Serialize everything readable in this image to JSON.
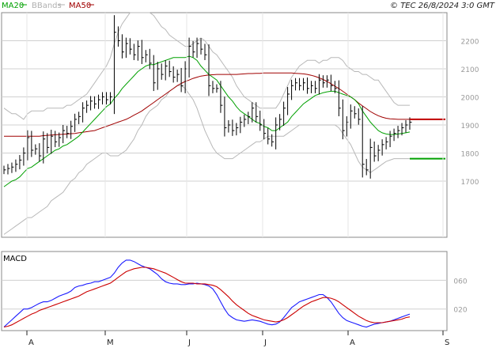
{
  "header": {
    "legend": [
      {
        "name": "MA20",
        "color": "#00a000"
      },
      {
        "name": "BBands",
        "color": "#b0b0b0"
      },
      {
        "name": "MA50",
        "color": "#a00000"
      }
    ],
    "copyright": "© TEC 26/8/2024 3:0 GMT"
  },
  "chart_data": [
    {
      "type": "line",
      "panel": "price",
      "grid": true,
      "ylim": [
        1500,
        2300
      ],
      "y_ticks": [
        1700,
        1800,
        1900,
        2000,
        2100,
        2200
      ],
      "x_labels": [
        "A",
        "M",
        "J",
        "J",
        "A",
        "S"
      ],
      "close": [
        1740,
        1745,
        1750,
        1760,
        1775,
        1800,
        1855,
        1810,
        1815,
        1790,
        1850,
        1820,
        1860,
        1840,
        1855,
        1880,
        1870,
        1895,
        1920,
        1930,
        1960,
        1970,
        1985,
        1975,
        1990,
        2000,
        1990,
        2000,
        2230,
        2200,
        2160,
        2190,
        2170,
        2150,
        2180,
        2140,
        2150,
        2120,
        2050,
        2100,
        2080,
        2110,
        2090,
        2070,
        2080,
        2040,
        2100,
        2180,
        2160,
        2190,
        2170,
        2150,
        2040,
        2030,
        2030,
        1970,
        1890,
        1900,
        1880,
        1890,
        1910,
        1920,
        1930,
        1960,
        1930,
        1900,
        1870,
        1850,
        1840,
        1900,
        1920,
        1960,
        2010,
        2040,
        2050,
        2040,
        2050,
        2030,
        2040,
        2030,
        2060,
        2050,
        2060,
        2040,
        2030,
        1960,
        1880,
        1910,
        1950,
        1940,
        1920,
        1760,
        1740,
        1820,
        1790,
        1810,
        1830,
        1840,
        1860,
        1870,
        1880,
        1890,
        1900,
        1910
      ],
      "ma20": [
        1680,
        1690,
        1700,
        1705,
        1715,
        1730,
        1745,
        1750,
        1760,
        1770,
        1780,
        1790,
        1800,
        1810,
        1815,
        1825,
        1830,
        1840,
        1850,
        1860,
        1875,
        1890,
        1905,
        1920,
        1935,
        1950,
        1965,
        1975,
        1995,
        2010,
        2030,
        2045,
        2060,
        2075,
        2090,
        2100,
        2110,
        2115,
        2115,
        2120,
        2125,
        2130,
        2135,
        2140,
        2140,
        2140,
        2140,
        2145,
        2140,
        2130,
        2110,
        2095,
        2080,
        2070,
        2060,
        2040,
        2020,
        2000,
        1985,
        1965,
        1950,
        1940,
        1930,
        1920,
        1910,
        1905,
        1895,
        1890,
        1880,
        1880,
        1890,
        1900,
        1910,
        1930,
        1945,
        1960,
        1975,
        1985,
        1995,
        2005,
        2010,
        2015,
        2018,
        2020,
        2020,
        2015,
        2010,
        2005,
        2000,
        1990,
        1975,
        1950,
        1930,
        1910,
        1895,
        1880,
        1872,
        1868,
        1866,
        1866,
        1868,
        1870,
        1872,
        1875
      ],
      "ma50": [
        1860,
        1860,
        1860,
        1860,
        1860,
        1860,
        1860,
        1860,
        1860,
        1860,
        1862,
        1863,
        1864,
        1865,
        1866,
        1867,
        1868,
        1869,
        1870,
        1872,
        1874,
        1876,
        1878,
        1880,
        1885,
        1890,
        1895,
        1900,
        1905,
        1910,
        1915,
        1920,
        1927,
        1935,
        1942,
        1950,
        1960,
        1970,
        1980,
        1990,
        2000,
        2010,
        2020,
        2030,
        2040,
        2048,
        2055,
        2060,
        2066,
        2070,
        2074,
        2076,
        2078,
        2079,
        2080,
        2080,
        2080,
        2080,
        2080,
        2080,
        2081,
        2082,
        2083,
        2083,
        2084,
        2084,
        2085,
        2085,
        2085,
        2085,
        2085,
        2085,
        2085,
        2085,
        2084,
        2083,
        2082,
        2080,
        2077,
        2073,
        2068,
        2062,
        2055,
        2047,
        2038,
        2030,
        2020,
        2010,
        2000,
        1990,
        1978,
        1968,
        1958,
        1948,
        1940,
        1933,
        1928,
        1924,
        1922,
        1921,
        1920,
        1920,
        1920,
        1920
      ],
      "bb_upper": [
        1960,
        1950,
        1940,
        1940,
        1930,
        1920,
        1940,
        1950,
        1950,
        1950,
        1950,
        1960,
        1960,
        1960,
        1960,
        1960,
        1970,
        1970,
        1980,
        1990,
        2000,
        2010,
        2030,
        2050,
        2070,
        2090,
        2110,
        2140,
        2190,
        2230,
        2260,
        2280,
        2300,
        2300,
        2300,
        2300,
        2300,
        2300,
        2290,
        2270,
        2250,
        2240,
        2220,
        2210,
        2200,
        2190,
        2180,
        2180,
        2190,
        2200,
        2210,
        2200,
        2180,
        2160,
        2150,
        2130,
        2110,
        2090,
        2070,
        2040,
        2020,
        2000,
        1990,
        1980,
        1970,
        1960,
        1960,
        1960,
        1960,
        1960,
        1980,
        2010,
        2040,
        2070,
        2090,
        2110,
        2120,
        2130,
        2130,
        2130,
        2120,
        2130,
        2130,
        2140,
        2140,
        2140,
        2130,
        2110,
        2100,
        2090,
        2090,
        2080,
        2080,
        2070,
        2060,
        2060,
        2040,
        2020,
        2000,
        1980,
        1970,
        1970,
        1970,
        1970
      ],
      "bb_lower": [
        1510,
        1520,
        1530,
        1540,
        1550,
        1560,
        1570,
        1570,
        1580,
        1590,
        1600,
        1610,
        1630,
        1640,
        1650,
        1660,
        1680,
        1700,
        1710,
        1730,
        1740,
        1760,
        1770,
        1780,
        1790,
        1800,
        1800,
        1790,
        1790,
        1790,
        1800,
        1810,
        1830,
        1850,
        1880,
        1900,
        1930,
        1950,
        1960,
        1970,
        1990,
        2000,
        2020,
        2030,
        2040,
        2040,
        2030,
        2010,
        1990,
        1960,
        1920,
        1880,
        1850,
        1820,
        1800,
        1790,
        1780,
        1780,
        1780,
        1790,
        1800,
        1810,
        1820,
        1830,
        1840,
        1840,
        1850,
        1860,
        1860,
        1860,
        1860,
        1860,
        1870,
        1880,
        1890,
        1900,
        1900,
        1900,
        1900,
        1900,
        1900,
        1900,
        1900,
        1900,
        1900,
        1890,
        1870,
        1850,
        1830,
        1800,
        1770,
        1750,
        1740,
        1730,
        1740,
        1750,
        1760,
        1770,
        1775,
        1780,
        1780,
        1780,
        1780,
        1780
      ]
    },
    {
      "type": "line",
      "panel": "macd",
      "title": "MACD",
      "ylim": [
        -10,
        100
      ],
      "y_ticks": [
        20,
        60
      ],
      "macd": [
        -5,
        0,
        5,
        10,
        15,
        20,
        20,
        22,
        25,
        28,
        30,
        30,
        32,
        35,
        38,
        40,
        42,
        45,
        50,
        52,
        53,
        55,
        56,
        58,
        58,
        60,
        62,
        64,
        70,
        78,
        84,
        88,
        88,
        86,
        83,
        80,
        78,
        76,
        72,
        68,
        62,
        58,
        56,
        55,
        55,
        54,
        54,
        55,
        55,
        56,
        55,
        54,
        52,
        48,
        40,
        30,
        20,
        12,
        8,
        5,
        4,
        3,
        4,
        5,
        4,
        3,
        1,
        -1,
        -2,
        -1,
        2,
        8,
        15,
        22,
        26,
        30,
        32,
        34,
        36,
        38,
        40,
        40,
        36,
        30,
        22,
        14,
        8,
        4,
        2,
        0,
        -2,
        -4,
        -5,
        -3,
        -1,
        0,
        1,
        2,
        3,
        5,
        7,
        9,
        11,
        13
      ],
      "signal": [
        -5,
        -4,
        -2,
        1,
        4,
        7,
        10,
        13,
        15,
        18,
        20,
        22,
        24,
        26,
        28,
        30,
        32,
        34,
        36,
        38,
        41,
        44,
        46,
        48,
        50,
        52,
        54,
        56,
        60,
        64,
        68,
        72,
        74,
        76,
        77,
        78,
        78,
        77,
        76,
        74,
        72,
        70,
        67,
        64,
        61,
        58,
        56,
        56,
        56,
        55,
        55,
        55,
        54,
        53,
        51,
        47,
        42,
        37,
        31,
        26,
        22,
        18,
        14,
        11,
        9,
        7,
        5,
        4,
        3,
        2,
        3,
        5,
        8,
        12,
        16,
        20,
        24,
        27,
        30,
        32,
        34,
        36,
        36,
        35,
        33,
        30,
        26,
        22,
        18,
        14,
        10,
        7,
        4,
        2,
        1,
        1,
        1,
        2,
        3,
        4,
        5,
        6,
        8,
        9
      ]
    }
  ]
}
